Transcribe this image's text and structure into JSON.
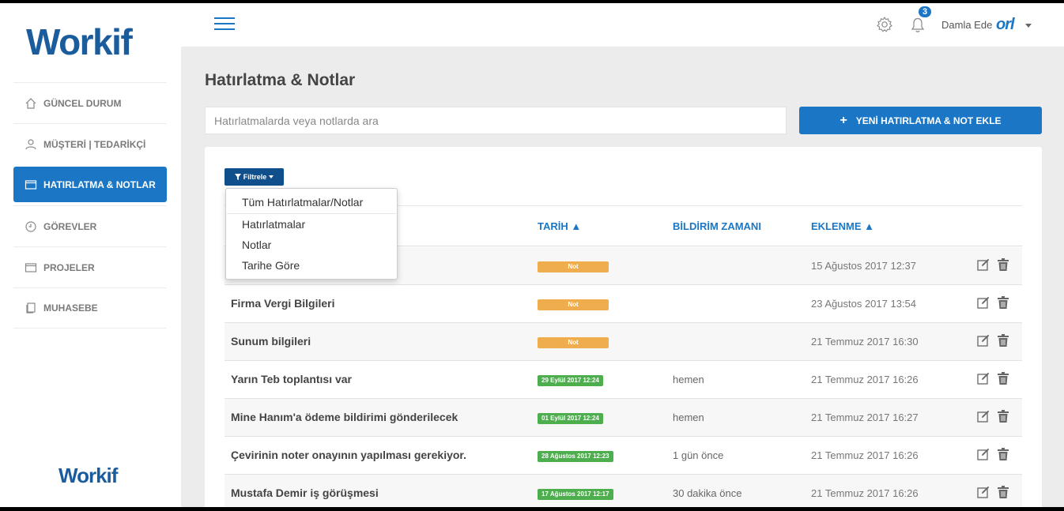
{
  "brand": {
    "logo": "Workif",
    "bottom_logo": "Workif",
    "accent": "#1b77c6",
    "dark_accent": "#0e4f8c"
  },
  "sidebar": {
    "items": [
      {
        "label": "GÜNCEL DURUM",
        "icon": "home-icon"
      },
      {
        "label": "MÜŞTERİ | TEDARİKÇİ",
        "icon": "user-icon"
      },
      {
        "label": "HATIRLATMA & NOTLAR",
        "icon": "folder-icon",
        "active": true
      },
      {
        "label": "GÖREVLER",
        "icon": "clock-icon"
      },
      {
        "label": "PROJELER",
        "icon": "folder-icon"
      },
      {
        "label": "MUHASEBE",
        "icon": "document-icon"
      }
    ]
  },
  "topbar": {
    "notification_count": "3",
    "user_name": "Damla Ede",
    "org_logo": "orl"
  },
  "main": {
    "title": "Hatırlatma & Notlar",
    "search_placeholder": "Hatırlatmalarda veya notlarda ara",
    "add_button": "YENİ HATIRLATMA & NOT EKLE",
    "add_icon": "+",
    "filter_button": "Filtrele",
    "filter_options": [
      "Tüm Hatırlatmalar/Notlar",
      "Hatırlatmalar",
      "Notlar",
      "Tarihe Göre"
    ],
    "columns": {
      "date": "TARİH ▲",
      "notify": "BİLDİRİM ZAMANI",
      "added": "EKLENME ▲"
    },
    "rows": [
      {
        "title": "",
        "badge": "Not",
        "badge_type": "not",
        "notify": "",
        "added": "15 Ağustos 2017 12:37"
      },
      {
        "title": "Firma Vergi Bilgileri",
        "badge": "Not",
        "badge_type": "not",
        "notify": "",
        "added": "23 Ağustos 2017 13:54"
      },
      {
        "title": "Sunum bilgileri",
        "badge": "Not",
        "badge_type": "not",
        "notify": "",
        "added": "21 Temmuz 2017 16:30"
      },
      {
        "title": "Yarın Teb toplantısı var",
        "badge": "29 Eylül 2017 12:24",
        "badge_type": "date",
        "notify": "hemen",
        "added": "21 Temmuz 2017 16:26"
      },
      {
        "title": "Mine Hanım'a ödeme bildirimi gönderilecek",
        "badge": "01 Eylül 2017 12:24",
        "badge_type": "date",
        "notify": "hemen",
        "added": "21 Temmuz 2017 16:27"
      },
      {
        "title": "Çevirinin noter onayının yapılması gerekiyor.",
        "badge": "28 Ağustos 2017 12:23",
        "badge_type": "date",
        "notify": "1 gün önce",
        "added": "21 Temmuz 2017 16:26"
      },
      {
        "title": "Mustafa Demir iş görüşmesi",
        "badge": "17 Ağustos 2017 12:17",
        "badge_type": "date",
        "notify": "30 dakika önce",
        "added": "21 Temmuz 2017 16:26"
      }
    ]
  }
}
